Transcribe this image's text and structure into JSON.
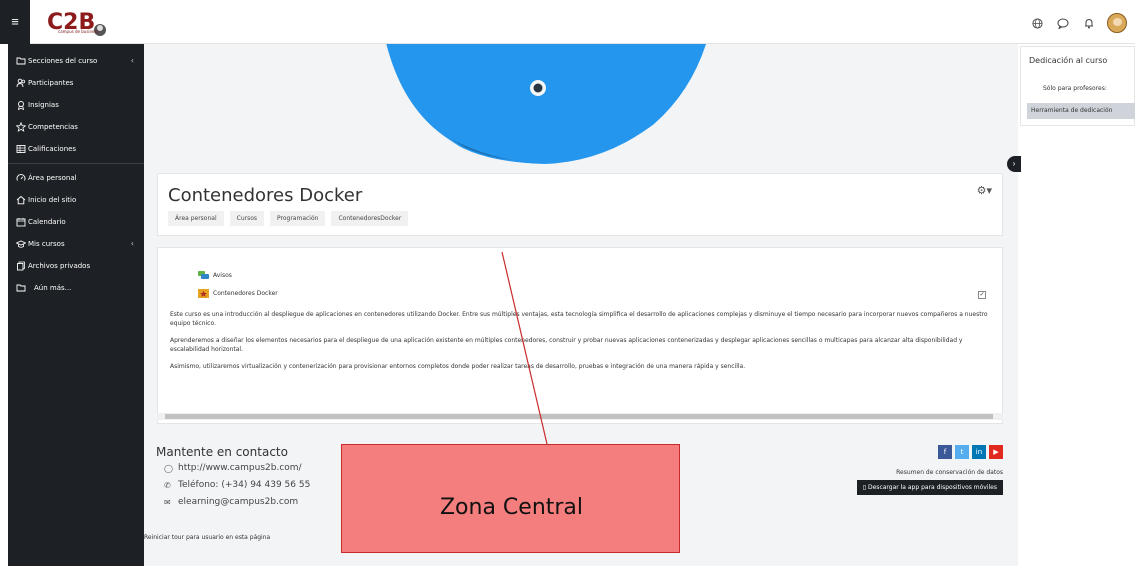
{
  "navbar": {
    "logo_text": "campus de business"
  },
  "sidebar": {
    "items": [
      {
        "label": "Secciones del curso",
        "icon": "folder-icon"
      },
      {
        "label": "Participantes",
        "icon": "users-icon"
      },
      {
        "label": "Insignias",
        "icon": "badge-icon"
      },
      {
        "label": "Competencias",
        "icon": "star-icon"
      },
      {
        "label": "Calificaciones",
        "icon": "table-icon"
      },
      {
        "label": "Área personal",
        "icon": "dashboard-icon"
      },
      {
        "label": "Inicio del sitio",
        "icon": "home-icon"
      },
      {
        "label": "Calendario",
        "icon": "calendar-icon"
      },
      {
        "label": "Mis cursos",
        "icon": "graduation-cap-icon"
      },
      {
        "label": "Archivos privados",
        "icon": "files-icon"
      },
      {
        "label": "Aún más...",
        "icon": "folder-icon"
      }
    ]
  },
  "header": {
    "title": "Contenedores Docker",
    "breadcrumb": [
      "Área personal",
      "Cursos",
      "Programación",
      "ContenedoresDocker"
    ]
  },
  "content": {
    "activities": [
      {
        "label": "Avisos",
        "icon": "forum-icon"
      },
      {
        "label": "Contenedores Docker",
        "icon": "lesson-icon"
      }
    ],
    "paragraphs": [
      "Este curso es una introducción al despliegue de aplicaciones en contenedores utilizando Docker. Entre sus múltiples ventajas, esta tecnología simplifica el desarrollo de aplicaciones complejas y disminuye el tiempo necesario para incorporar nuevos compañeros a nuestro equipo técnico.",
      "Aprenderemos a diseñar los elementos necesarios para el despliegue de una aplicación existente en múltiples contenedores, construir y probar nuevas aplicaciones contenerizadas y desplegar aplicaciones sencillas o multicapas para alcanzar alta disponibilidad y escalabilidad horizontal.",
      "Asimismo, utilizaremos virtualización y contenerización para provisionar entornos completos donde poder realizar tareas de desarrollo, pruebas e integración de una manera rápida y sencilla."
    ]
  },
  "footer": {
    "title": "Mantente en contacto",
    "website": "http://www.campus2b.com/",
    "phone": "Teléfono: (+34) 94 439 56 55",
    "email": "elearning@campus2b.com",
    "tour": "Reiniciar tour para usuario en esta página",
    "privacy": "Resumen de conservación de datos",
    "app_button": "Descargar la app para dispositivos móviles",
    "socials": [
      {
        "label": "f",
        "color": "#3b5998",
        "icon": "facebook-icon"
      },
      {
        "label": "t",
        "color": "#55acee",
        "icon": "twitter-icon"
      },
      {
        "label": "in",
        "color": "#0077b5",
        "icon": "linkedin-icon"
      },
      {
        "label": "▶",
        "color": "#e02a20",
        "icon": "youtube-icon"
      }
    ]
  },
  "block": {
    "title": "Dedicación al curso",
    "note": "Sólo para profesores:",
    "button": "Herramienta de dedicación"
  },
  "annotation": {
    "label": "Zona Central"
  },
  "colors": {
    "sidebar_bg": "#1d2125",
    "annotation_fill": "#f47e7e",
    "annotation_line": "#c82b2b",
    "docker_blue": "#2496ed"
  }
}
